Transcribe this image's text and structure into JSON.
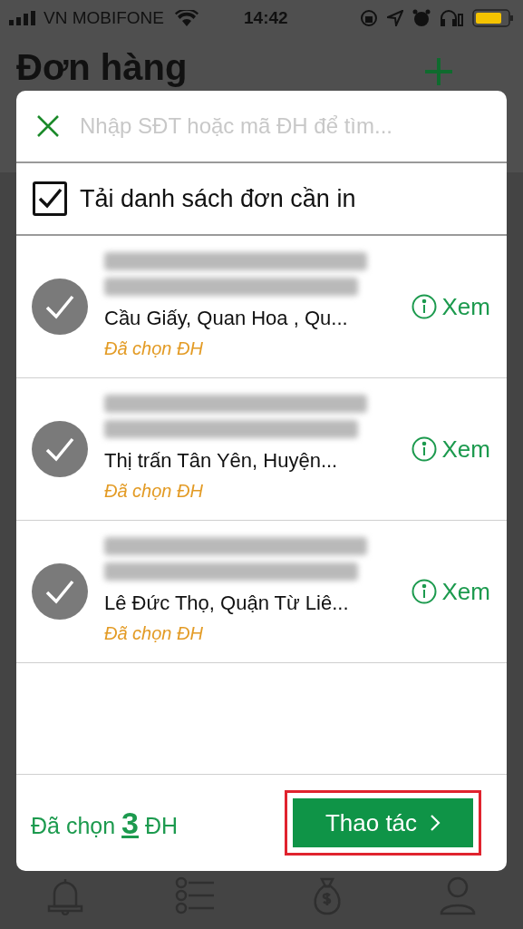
{
  "status_bar": {
    "carrier": "VN MOBIFONE",
    "time": "14:42"
  },
  "page": {
    "title": "Đơn hàng"
  },
  "modal": {
    "search": {
      "placeholder": "Nhập SĐT hoặc mã ĐH để tìm..."
    },
    "load_list": {
      "label": "Tải danh sách đơn cần in",
      "checked": true
    },
    "orders": [
      {
        "address": "Cầu Giấy, Quan Hoa , Qu...",
        "status": "Đã chọn ĐH",
        "selected": true,
        "view": "Xem"
      },
      {
        "address": "Thị trấn Tân Yên, Huyện...",
        "status": "Đã chọn ĐH",
        "selected": true,
        "view": "Xem"
      },
      {
        "address": "Lê Đức Thọ, Quận Từ Liê...",
        "status": "Đã chọn ĐH",
        "selected": true,
        "view": "Xem"
      }
    ],
    "footer": {
      "text_before": "Đã chọn",
      "count": "3",
      "text_after": "ĐH",
      "action": "Thao tác",
      "highlighted": true
    }
  },
  "tab_bar": [
    {
      "kind": "bell"
    },
    {
      "kind": "checklist"
    },
    {
      "kind": "moneybag"
    },
    {
      "kind": "user"
    }
  ]
}
